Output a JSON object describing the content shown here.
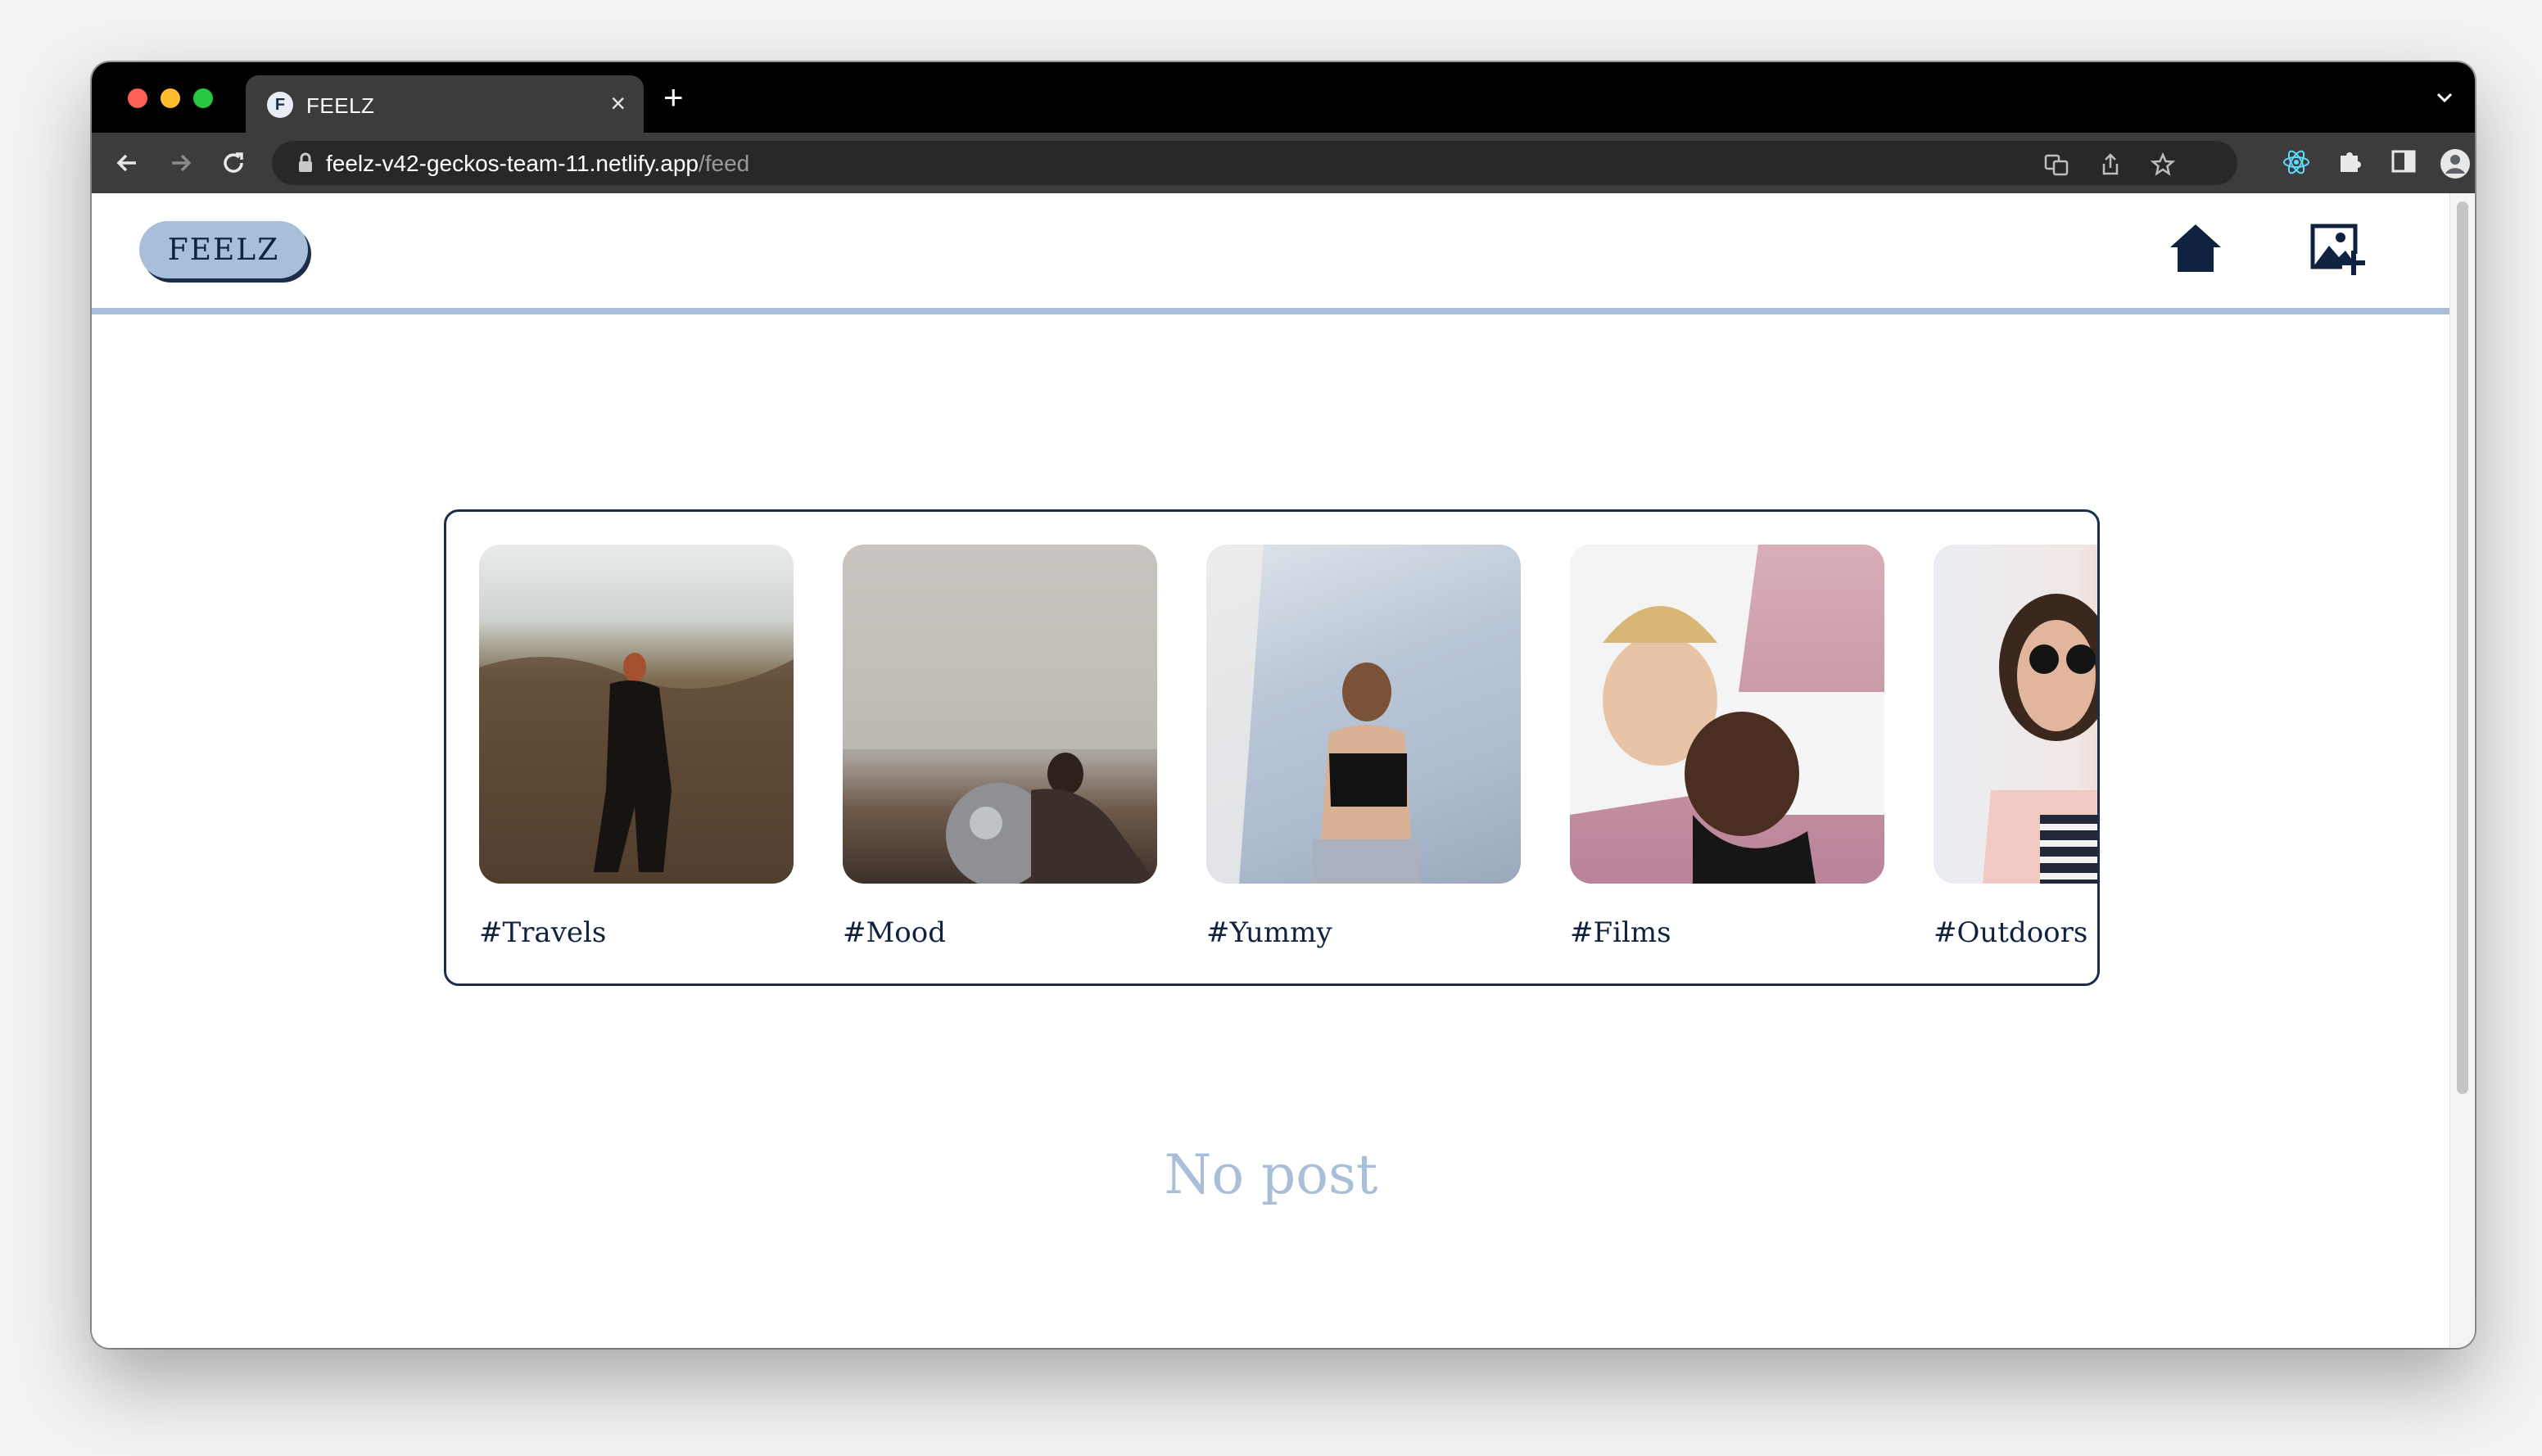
{
  "browser": {
    "tab_title": "FEELZ",
    "tab_favicon_letter": "F",
    "url_host": "feelz-v42-geckos-team-11.netlify.app",
    "url_path": "/feed"
  },
  "header": {
    "logo": "FEELZ",
    "nav_icons": [
      "home-icon",
      "add-image-icon"
    ]
  },
  "categories": [
    {
      "label": "#Travels"
    },
    {
      "label": "#Mood"
    },
    {
      "label": "#Yummy"
    },
    {
      "label": "#Films"
    },
    {
      "label": "#Outdoors"
    }
  ],
  "feed": {
    "empty_message": "No post"
  },
  "colors": {
    "brand_light": "#a9bfd9",
    "brand_dark": "#0f2340",
    "chrome_dark": "#3c3c3c"
  }
}
